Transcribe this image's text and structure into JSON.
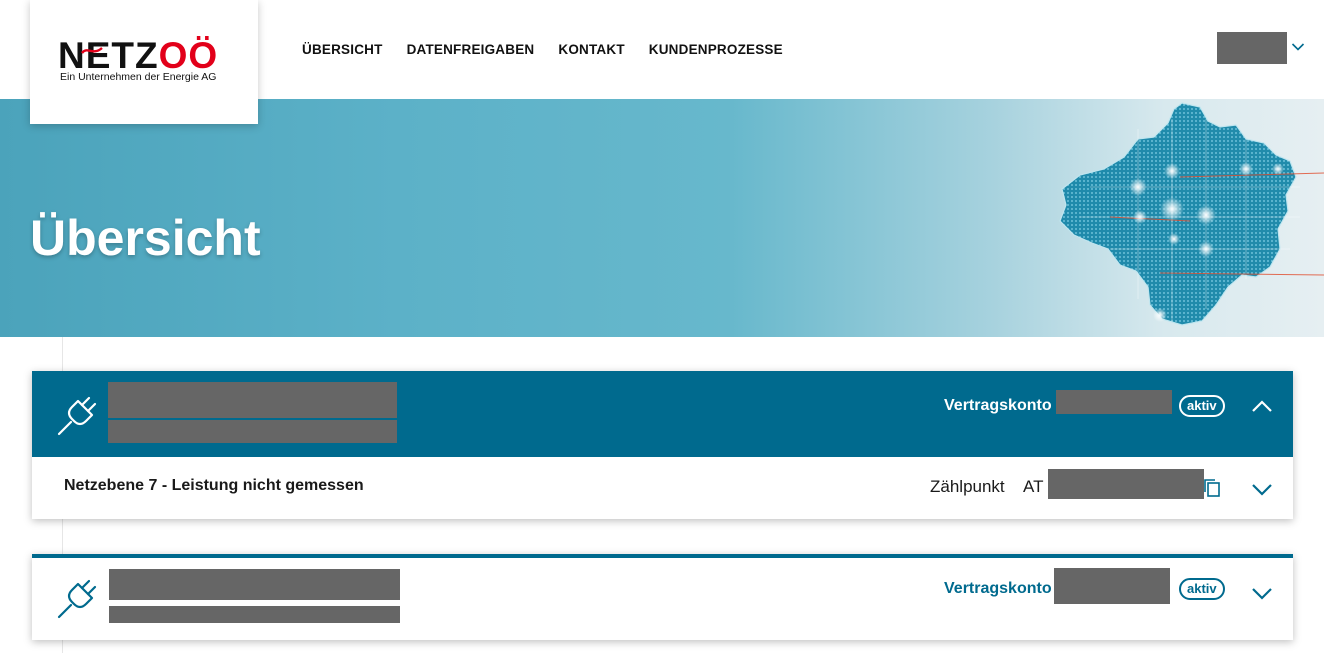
{
  "logo": {
    "word_black": "NETZ",
    "word_red": "OÖ",
    "tagline": "Ein Unternehmen der Energie AG"
  },
  "nav": [
    {
      "label": "ÜBERSICHT"
    },
    {
      "label": "DATENFREIGABEN"
    },
    {
      "label": "KONTAKT"
    },
    {
      "label": "KUNDENPROZESSE"
    }
  ],
  "hero": {
    "title": "Übersicht"
  },
  "cards": [
    {
      "vertragskonto_label": "Vertragskonto",
      "status": "aktiv",
      "expanded": true,
      "netzebene": "Netzebene 7 - Leistung nicht gemessen",
      "zaehlpunkt_label": "Zählpunkt",
      "zaehlpunkt_prefix": "AT"
    },
    {
      "vertragskonto_label": "Vertragskonto",
      "status": "aktiv",
      "expanded": false
    }
  ],
  "colors": {
    "brand_blue": "#006a8e",
    "logo_red": "#e2001a",
    "redaction": "#666666"
  },
  "icons": [
    "plug-icon",
    "copy-icon",
    "chevron-up-icon",
    "chevron-down-icon"
  ]
}
